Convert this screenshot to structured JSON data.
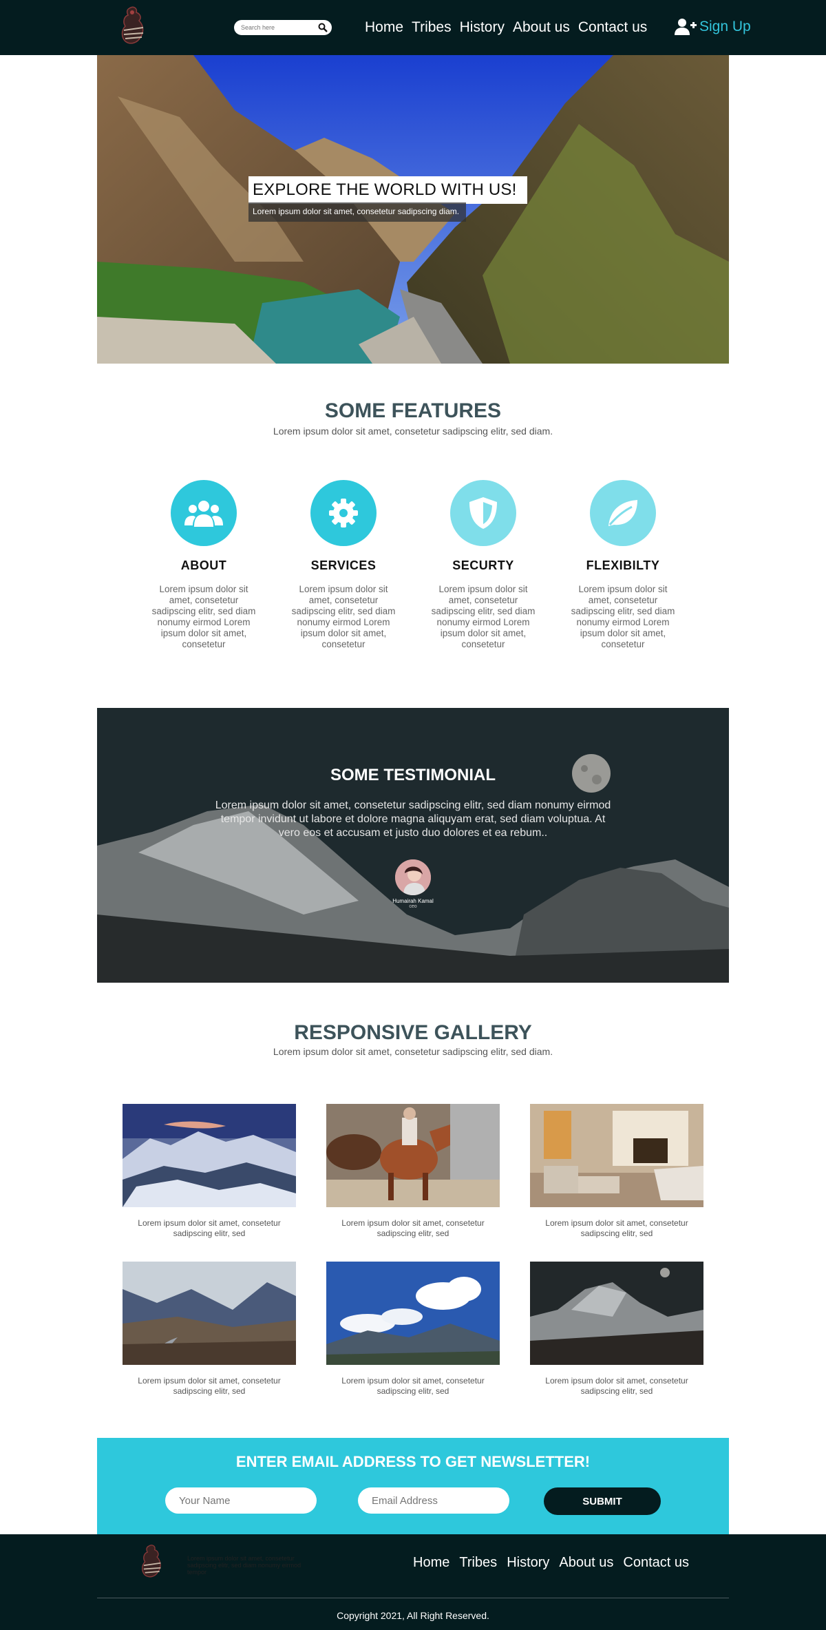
{
  "nav": {
    "search_placeholder": "Search here",
    "links": [
      "Home",
      "Tribes",
      "History",
      "About us",
      "Contact us"
    ],
    "signup": "Sign Up"
  },
  "hero": {
    "title": "EXPLORE THE WORLD WITH US!",
    "subtitle": "Lorem ipsum dolor sit amet, consetetur sadipscing diam."
  },
  "features": {
    "title": "SOME FEATURES",
    "subtitle": "Lorem ipsum dolor sit amet, consetetur sadipscing elitr, sed diam.",
    "items": [
      {
        "title": "ABOUT",
        "icon": "users-icon",
        "color": "#2ec8dc",
        "text": "Lorem ipsum dolor sit amet, consetetur sadipscing elitr, sed diam nonumy eirmod Lorem ipsum dolor sit amet, consetetur"
      },
      {
        "title": "SERVICES",
        "icon": "gear-icon",
        "color": "#2ec8dc",
        "text": "Lorem ipsum dolor sit amet, consetetur sadipscing elitr, sed diam nonumy eirmod Lorem ipsum dolor sit amet, consetetur"
      },
      {
        "title": "SECURTY",
        "icon": "shield-icon",
        "color": "#7fdeea",
        "text": "Lorem ipsum dolor sit amet, consetetur sadipscing elitr, sed diam nonumy eirmod Lorem ipsum dolor sit amet, consetetur"
      },
      {
        "title": "FLEXIBILTY",
        "icon": "leaf-icon",
        "color": "#7fdeea",
        "text": "Lorem ipsum dolor sit amet, consetetur sadipscing elitr, sed diam nonumy eirmod Lorem ipsum dolor sit amet, consetetur"
      }
    ]
  },
  "testimonial": {
    "title": "SOME TESTIMONIAL",
    "text": "Lorem ipsum dolor sit amet, consetetur sadipscing elitr, sed diam nonumy eirmod tempor invidunt ut labore et dolore magna aliquyam erat, sed diam voluptua. At vero eos et accusam et justo duo dolores et ea rebum..",
    "name": "Humairah Kamal",
    "role": "ceo"
  },
  "gallery": {
    "title": "RESPONSIVE GALLERY",
    "subtitle": "Lorem ipsum dolor sit amet, consetetur sadipscing elitr, sed diam.",
    "items": [
      {
        "caption": "Lorem ipsum dolor sit amet, consetetur sadipscing elitr, sed"
      },
      {
        "caption": "Lorem ipsum dolor sit amet, consetetur sadipscing elitr, sed"
      },
      {
        "caption": "Lorem ipsum dolor sit amet, consetetur sadipscing elitr, sed"
      },
      {
        "caption": "Lorem ipsum dolor sit amet, consetetur sadipscing elitr, sed"
      },
      {
        "caption": "Lorem ipsum dolor sit amet, consetetur sadipscing elitr, sed"
      },
      {
        "caption": "Lorem ipsum dolor sit amet, consetetur sadipscing elitr, sed"
      }
    ]
  },
  "newsletter": {
    "title": "ENTER EMAIL ADDRESS TO GET NEWSLETTER!",
    "name_placeholder": "Your Name",
    "email_placeholder": "Email Address",
    "submit": "SUBMIT"
  },
  "footer": {
    "text": "Lorem ipsum dolor sit amet, consetetur sadipscing elitr, sed diam nonumy eirmod tempor",
    "links": [
      "Home",
      "Tribes",
      "History",
      "About us",
      "Contact us"
    ],
    "copyright": "Copyright 2021, All Right Reserved."
  }
}
